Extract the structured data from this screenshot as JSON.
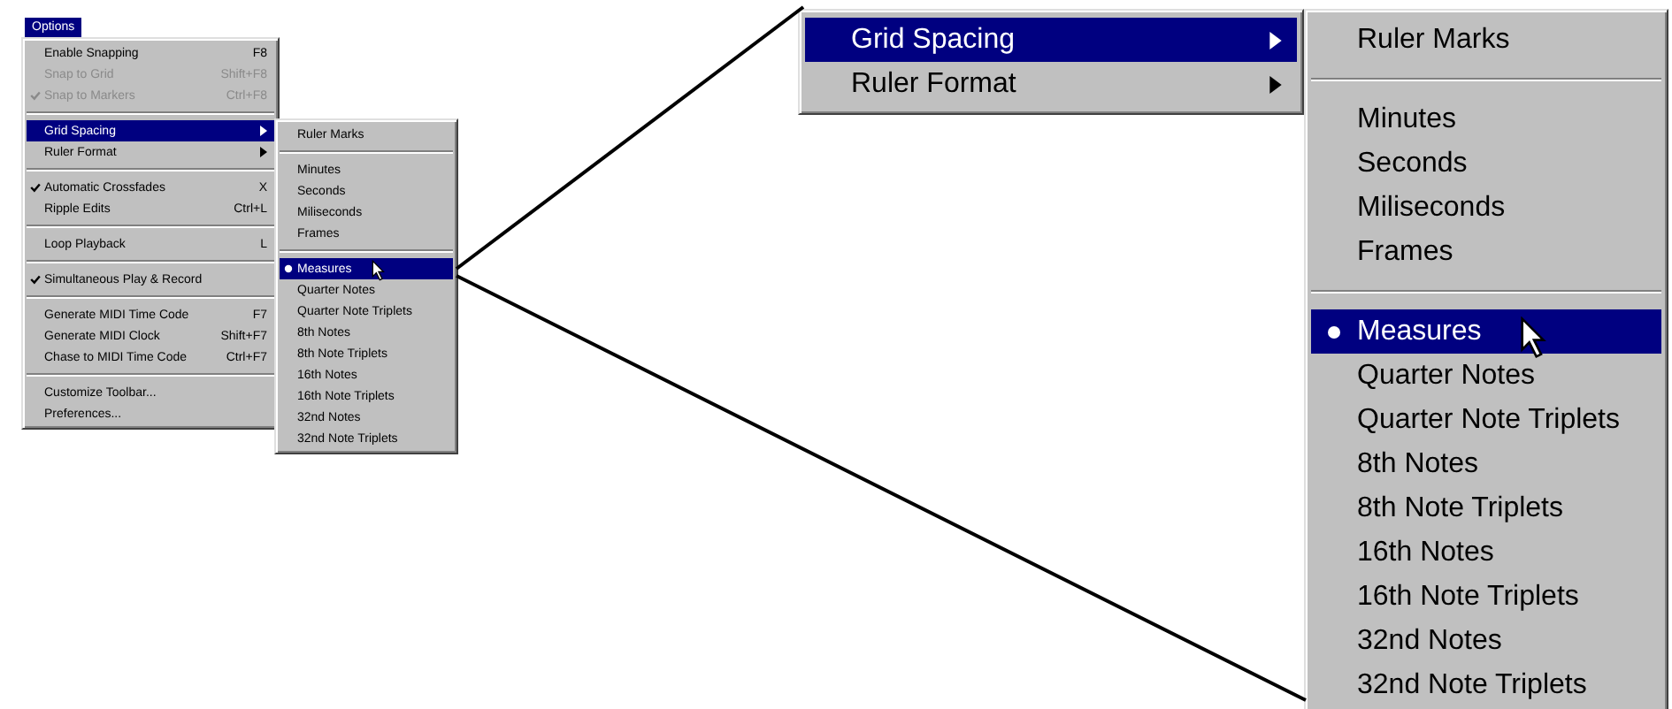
{
  "menu_bar": {
    "title": "Options",
    "selected": true
  },
  "options_menu": [
    {
      "kind": "item",
      "label": "Enable Snapping",
      "shortcut": "F8",
      "disabled": false,
      "checked": false,
      "selected": false,
      "submenu": false
    },
    {
      "kind": "item",
      "label": "Snap to Grid",
      "shortcut": "Shift+F8",
      "disabled": true,
      "checked": false,
      "selected": false,
      "submenu": false
    },
    {
      "kind": "item",
      "label": "Snap to Markers",
      "shortcut": "Ctrl+F8",
      "disabled": true,
      "checked": true,
      "selected": false,
      "submenu": false
    },
    {
      "kind": "separator"
    },
    {
      "kind": "item",
      "label": "Grid Spacing",
      "disabled": false,
      "checked": false,
      "selected": true,
      "submenu": true
    },
    {
      "kind": "item",
      "label": "Ruler Format",
      "disabled": false,
      "checked": false,
      "selected": false,
      "submenu": true
    },
    {
      "kind": "separator"
    },
    {
      "kind": "item",
      "label": "Automatic Crossfades",
      "shortcut": "X",
      "disabled": false,
      "checked": true,
      "selected": false,
      "submenu": false
    },
    {
      "kind": "item",
      "label": "Ripple Edits",
      "shortcut": "Ctrl+L",
      "disabled": false,
      "checked": false,
      "selected": false,
      "submenu": false
    },
    {
      "kind": "separator"
    },
    {
      "kind": "item",
      "label": "Loop Playback",
      "shortcut": "L",
      "disabled": false,
      "checked": false,
      "selected": false,
      "submenu": false
    },
    {
      "kind": "separator"
    },
    {
      "kind": "item",
      "label": "Simultaneous Play & Record",
      "disabled": false,
      "checked": true,
      "selected": false,
      "submenu": false
    },
    {
      "kind": "separator"
    },
    {
      "kind": "item",
      "label": "Generate MIDI Time Code",
      "shortcut": "F7",
      "disabled": false,
      "checked": false,
      "selected": false,
      "submenu": false
    },
    {
      "kind": "item",
      "label": "Generate MIDI Clock",
      "shortcut": "Shift+F7",
      "disabled": false,
      "checked": false,
      "selected": false,
      "submenu": false
    },
    {
      "kind": "item",
      "label": "Chase to MIDI Time Code",
      "shortcut": "Ctrl+F7",
      "disabled": false,
      "checked": false,
      "selected": false,
      "submenu": false
    },
    {
      "kind": "separator"
    },
    {
      "kind": "item",
      "label": "Customize Toolbar...",
      "disabled": false,
      "checked": false,
      "selected": false,
      "submenu": false
    },
    {
      "kind": "item",
      "label": "Preferences...",
      "disabled": false,
      "checked": false,
      "selected": false,
      "submenu": false
    }
  ],
  "grid_spacing_menu": [
    {
      "kind": "item",
      "label": "Ruler Marks",
      "checked": false,
      "selected": false
    },
    {
      "kind": "separator"
    },
    {
      "kind": "item",
      "label": "Minutes",
      "checked": false,
      "selected": false
    },
    {
      "kind": "item",
      "label": "Seconds",
      "checked": false,
      "selected": false
    },
    {
      "kind": "item",
      "label": "Miliseconds",
      "checked": false,
      "selected": false
    },
    {
      "kind": "item",
      "label": "Frames",
      "checked": false,
      "selected": false
    },
    {
      "kind": "separator"
    },
    {
      "kind": "item",
      "label": "Measures",
      "checked": true,
      "selected": true
    },
    {
      "kind": "item",
      "label": "Quarter Notes",
      "checked": false,
      "selected": false
    },
    {
      "kind": "item",
      "label": "Quarter Note Triplets",
      "checked": false,
      "selected": false
    },
    {
      "kind": "item",
      "label": "8th Notes",
      "checked": false,
      "selected": false
    },
    {
      "kind": "item",
      "label": "8th Note Triplets",
      "checked": false,
      "selected": false
    },
    {
      "kind": "item",
      "label": "16th Notes",
      "checked": false,
      "selected": false
    },
    {
      "kind": "item",
      "label": "16th Note Triplets",
      "checked": false,
      "selected": false
    },
    {
      "kind": "item",
      "label": "32nd Notes",
      "checked": false,
      "selected": false
    },
    {
      "kind": "item",
      "label": "32nd Note Triplets",
      "checked": false,
      "selected": false
    }
  ],
  "zoom_parent_menu": [
    {
      "kind": "item",
      "label": "Grid Spacing",
      "selected": true,
      "submenu": true
    },
    {
      "kind": "item",
      "label": "Ruler Format",
      "selected": false,
      "submenu": true
    }
  ],
  "zoom_grid_spacing_menu": [
    {
      "kind": "item",
      "label": "Ruler Marks",
      "checked": false,
      "selected": false
    },
    {
      "kind": "separator"
    },
    {
      "kind": "item",
      "label": "Minutes",
      "checked": false,
      "selected": false
    },
    {
      "kind": "item",
      "label": "Seconds",
      "checked": false,
      "selected": false
    },
    {
      "kind": "item",
      "label": "Miliseconds",
      "checked": false,
      "selected": false
    },
    {
      "kind": "item",
      "label": "Frames",
      "checked": false,
      "selected": false
    },
    {
      "kind": "separator"
    },
    {
      "kind": "item",
      "label": "Measures",
      "checked": true,
      "selected": true
    },
    {
      "kind": "item",
      "label": "Quarter Notes",
      "checked": false,
      "selected": false
    },
    {
      "kind": "item",
      "label": "Quarter Note Triplets",
      "checked": false,
      "selected": false
    },
    {
      "kind": "item",
      "label": "8th Notes",
      "checked": false,
      "selected": false
    },
    {
      "kind": "item",
      "label": "8th Note Triplets",
      "checked": false,
      "selected": false
    },
    {
      "kind": "item",
      "label": "16th Notes",
      "checked": false,
      "selected": false
    },
    {
      "kind": "item",
      "label": "16th Note Triplets",
      "checked": false,
      "selected": false
    },
    {
      "kind": "item",
      "label": "32nd Notes",
      "checked": false,
      "selected": false
    },
    {
      "kind": "item",
      "label": "32nd Note Triplets",
      "checked": false,
      "selected": false
    }
  ]
}
